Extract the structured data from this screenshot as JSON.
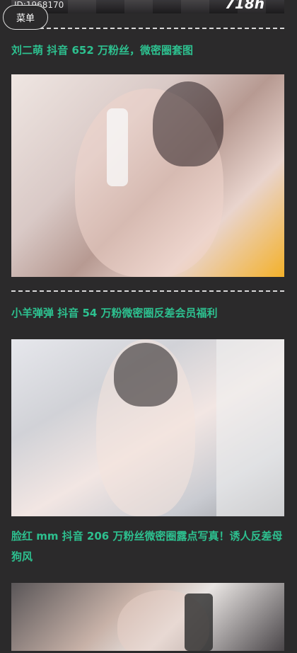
{
  "menu": {
    "label": "菜单"
  },
  "top_image": {
    "id_text": "ID:1968170",
    "watermark": "718h"
  },
  "posts": [
    {
      "title": "刘二萌 抖音 652 万粉丝，微密圈套图",
      "image_alt": "photo"
    },
    {
      "title": "小羊弹弹 抖音 54 万粉微密圈反差会员福利",
      "image_alt": "photo"
    },
    {
      "title": "脸红 mm 抖音 206 万粉丝微密圈露点写真！诱人反差母狗风",
      "image_alt": "photo"
    }
  ],
  "colors": {
    "background": "#2b2a2b",
    "title": "#2dc08f",
    "divider": "#d8d8d8"
  }
}
